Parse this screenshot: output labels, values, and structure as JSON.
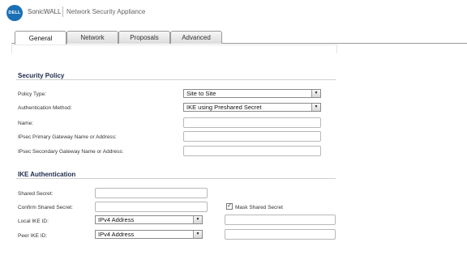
{
  "header": {
    "logo_text": "DELL",
    "brand": "SonicWALL",
    "product": "Network Security Appliance"
  },
  "tabs": [
    {
      "label": "General",
      "active": true
    },
    {
      "label": "Network",
      "active": false
    },
    {
      "label": "Proposals",
      "active": false
    },
    {
      "label": "Advanced",
      "active": false
    }
  ],
  "security_policy": {
    "title": "Security Policy",
    "policy_type_label": "Policy Type:",
    "policy_type_value": "Site to Site",
    "auth_method_label": "Authentication Method:",
    "auth_method_value": "IKE using Preshared Secret",
    "name_label": "Name:",
    "name_value": "",
    "primary_gw_label": "IPsec Primary Gateway Name or Address:",
    "primary_gw_value": "",
    "secondary_gw_label": "IPsec Secondary Gateway Name or Address:",
    "secondary_gw_value": ""
  },
  "ike_auth": {
    "title": "IKE Authentication",
    "shared_secret_label": "Shared Secret:",
    "confirm_secret_label": "Confirm Shared Secret:",
    "mask_label": "Mask Shared Secret",
    "mask_checked": true,
    "local_id_label": "Local IKE ID:",
    "local_id_type": "IPv4 Address",
    "peer_id_label": "Peer IKE ID:",
    "peer_id_type": "IPv4 Address"
  },
  "icons": {
    "dropdown": "chevron-down-icon",
    "check": "check-icon"
  }
}
